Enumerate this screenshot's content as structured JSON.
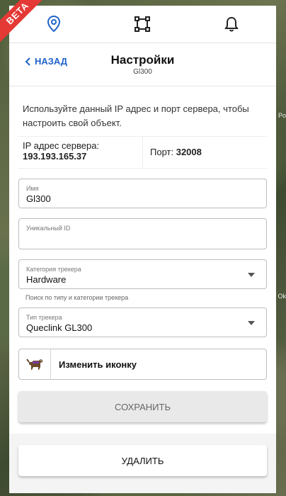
{
  "badge": "BETA",
  "map_side_labels": [
    "Po",
    "Ok"
  ],
  "topnav": {
    "icons": [
      "location-pin-icon",
      "crop-square-icon",
      "bell-icon"
    ]
  },
  "header": {
    "back_label": "НАЗАД",
    "title": "Настройки",
    "subtitle": "Gl300"
  },
  "info": {
    "text": "Используйте данный IP адрес и порт сервера, чтобы настроить свой объект."
  },
  "server": {
    "ip_label": "IP адрес сервера:",
    "ip_value": "193.193.165.37",
    "port_label": "Порт:",
    "port_value": "32008"
  },
  "fields": {
    "name": {
      "label": "Имя",
      "value": "Gl300"
    },
    "uid": {
      "label": "Уникальный ID",
      "value": ""
    },
    "category": {
      "label": "Категория трекера",
      "value": "Hardware",
      "hint": "Поиск по типу и категории трекера"
    },
    "type": {
      "label": "Тип трекера",
      "value": "Queclink GL300"
    }
  },
  "icon_change": {
    "label": "Изменить иконку",
    "icon": "dog-icon"
  },
  "buttons": {
    "save": "СОХРАНИТЬ",
    "delete": "УДАЛИТЬ"
  },
  "colors": {
    "accent": "#1e63c9",
    "beta": "#e53935"
  }
}
